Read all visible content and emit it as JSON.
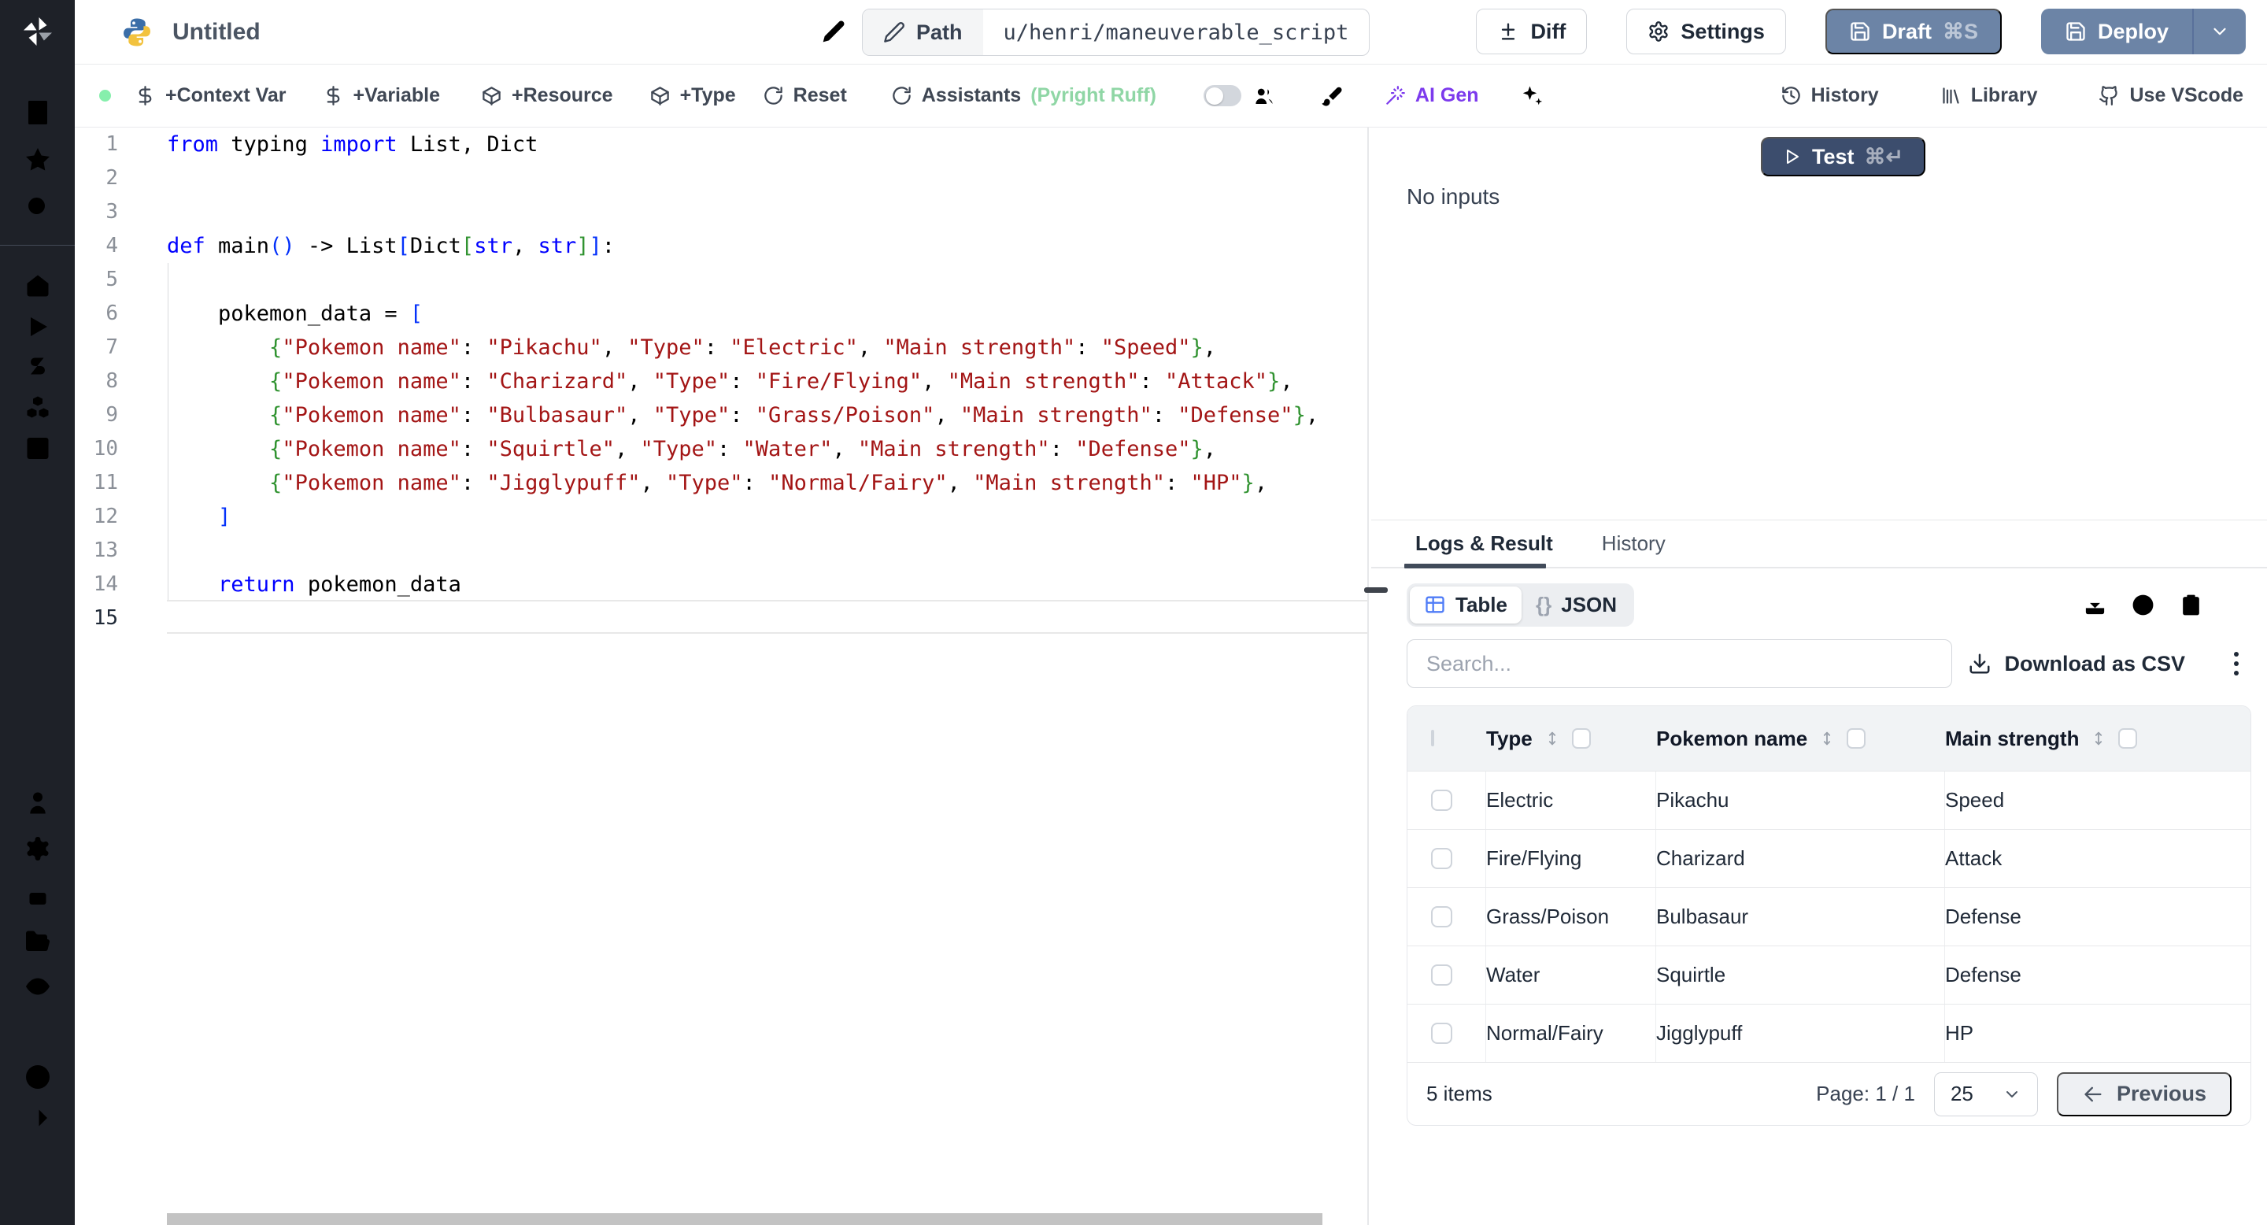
{
  "topbar": {
    "title": "Untitled",
    "path_label": "Path",
    "path_value": "u/henri/maneuverable_script",
    "diff_label": "Diff",
    "settings_label": "Settings",
    "draft_label": "Draft",
    "draft_kbd": "⌘S",
    "deploy_label": "Deploy"
  },
  "toolbar": {
    "context_var": "+Context Var",
    "variable": "+Variable",
    "resource": "+Resource",
    "type": "+Type",
    "reset": "Reset",
    "assistants": "Assistants",
    "assistants_status": "(Pyright Ruff)",
    "ai_gen": "AI Gen",
    "history": "History",
    "library": "Library",
    "use_vscode": "Use VScode"
  },
  "editor": {
    "current_line": 15,
    "lines": [
      [
        [
          "kw",
          "from"
        ],
        [
          "tx",
          " typing "
        ],
        [
          "kw",
          "import"
        ],
        [
          "tx",
          " List, Dict"
        ]
      ],
      [],
      [],
      [
        [
          "kw",
          "def"
        ],
        [
          "tx",
          " main"
        ],
        [
          "b1",
          "()"
        ],
        [
          "tx",
          " -> List"
        ],
        [
          "b1",
          "["
        ],
        [
          "tx",
          "Dict"
        ],
        [
          "b2",
          "["
        ],
        [
          "kw",
          "str"
        ],
        [
          "tx",
          ", "
        ],
        [
          "kw",
          "str"
        ],
        [
          "b2",
          "]"
        ],
        [
          "b1",
          "]"
        ],
        [
          "tx",
          ":"
        ]
      ],
      [],
      [
        [
          "tx",
          "    pokemon_data = "
        ],
        [
          "b1",
          "["
        ]
      ],
      [
        [
          "tx",
          "        "
        ],
        [
          "b2",
          "{"
        ],
        [
          "s",
          "\"Pokemon name\""
        ],
        [
          "tx",
          ": "
        ],
        [
          "s",
          "\"Pikachu\""
        ],
        [
          "tx",
          ", "
        ],
        [
          "s",
          "\"Type\""
        ],
        [
          "tx",
          ": "
        ],
        [
          "s",
          "\"Electric\""
        ],
        [
          "tx",
          ", "
        ],
        [
          "s",
          "\"Main strength\""
        ],
        [
          "tx",
          ": "
        ],
        [
          "s",
          "\"Speed\""
        ],
        [
          "b2",
          "}"
        ],
        [
          "tx",
          ","
        ]
      ],
      [
        [
          "tx",
          "        "
        ],
        [
          "b2",
          "{"
        ],
        [
          "s",
          "\"Pokemon name\""
        ],
        [
          "tx",
          ": "
        ],
        [
          "s",
          "\"Charizard\""
        ],
        [
          "tx",
          ", "
        ],
        [
          "s",
          "\"Type\""
        ],
        [
          "tx",
          ": "
        ],
        [
          "s",
          "\"Fire/Flying\""
        ],
        [
          "tx",
          ", "
        ],
        [
          "s",
          "\"Main strength\""
        ],
        [
          "tx",
          ": "
        ],
        [
          "s",
          "\"Attack\""
        ],
        [
          "b2",
          "}"
        ],
        [
          "tx",
          ","
        ]
      ],
      [
        [
          "tx",
          "        "
        ],
        [
          "b2",
          "{"
        ],
        [
          "s",
          "\"Pokemon name\""
        ],
        [
          "tx",
          ": "
        ],
        [
          "s",
          "\"Bulbasaur\""
        ],
        [
          "tx",
          ", "
        ],
        [
          "s",
          "\"Type\""
        ],
        [
          "tx",
          ": "
        ],
        [
          "s",
          "\"Grass/Poison\""
        ],
        [
          "tx",
          ", "
        ],
        [
          "s",
          "\"Main strength\""
        ],
        [
          "tx",
          ": "
        ],
        [
          "s",
          "\"Defense\""
        ],
        [
          "b2",
          "}"
        ],
        [
          "tx",
          ","
        ]
      ],
      [
        [
          "tx",
          "        "
        ],
        [
          "b2",
          "{"
        ],
        [
          "s",
          "\"Pokemon name\""
        ],
        [
          "tx",
          ": "
        ],
        [
          "s",
          "\"Squirtle\""
        ],
        [
          "tx",
          ", "
        ],
        [
          "s",
          "\"Type\""
        ],
        [
          "tx",
          ": "
        ],
        [
          "s",
          "\"Water\""
        ],
        [
          "tx",
          ", "
        ],
        [
          "s",
          "\"Main strength\""
        ],
        [
          "tx",
          ": "
        ],
        [
          "s",
          "\"Defense\""
        ],
        [
          "b2",
          "}"
        ],
        [
          "tx",
          ","
        ]
      ],
      [
        [
          "tx",
          "        "
        ],
        [
          "b2",
          "{"
        ],
        [
          "s",
          "\"Pokemon name\""
        ],
        [
          "tx",
          ": "
        ],
        [
          "s",
          "\"Jigglypuff\""
        ],
        [
          "tx",
          ", "
        ],
        [
          "s",
          "\"Type\""
        ],
        [
          "tx",
          ": "
        ],
        [
          "s",
          "\"Normal/Fairy\""
        ],
        [
          "tx",
          ", "
        ],
        [
          "s",
          "\"Main strength\""
        ],
        [
          "tx",
          ": "
        ],
        [
          "s",
          "\"HP\""
        ],
        [
          "b2",
          "}"
        ],
        [
          "tx",
          ","
        ]
      ],
      [
        [
          "tx",
          "    "
        ],
        [
          "b1",
          "]"
        ]
      ],
      [],
      [
        [
          "tx",
          "    "
        ],
        [
          "kw",
          "return"
        ],
        [
          "tx",
          " pokemon_data"
        ]
      ],
      []
    ]
  },
  "run_panel": {
    "test_label": "Test",
    "test_kbd": "⌘↵",
    "no_inputs": "No inputs"
  },
  "results": {
    "tabs": [
      "Logs & Result",
      "History"
    ],
    "active_tab": "Logs & Result",
    "view_table": "Table",
    "view_json_glyph": "{}",
    "view_json": "JSON",
    "search_placeholder": "Search...",
    "download_csv": "Download as CSV",
    "table": {
      "columns": [
        "Type",
        "Pokemon name",
        "Main strength"
      ],
      "rows": [
        [
          "Electric",
          "Pikachu",
          "Speed"
        ],
        [
          "Fire/Flying",
          "Charizard",
          "Attack"
        ],
        [
          "Grass/Poison",
          "Bulbasaur",
          "Defense"
        ],
        [
          "Water",
          "Squirtle",
          "Defense"
        ],
        [
          "Normal/Fairy",
          "Jigglypuff",
          "HP"
        ]
      ]
    },
    "footer": {
      "items": "5 items",
      "page": "Page: 1 / 1",
      "page_size": "25",
      "previous": "Previous"
    }
  },
  "colors": {
    "sidebar_bg": "#1e2128",
    "accent_button": "#6c84a6",
    "test_button": "#3c4d6d",
    "status_green": "#86efac",
    "assistants_green": "#8fd6a5",
    "ai_violet": "#7c3aed",
    "code_keyword": "#0000ff",
    "code_string": "#a31515",
    "bracket_level1": "#0431fa",
    "bracket_level2": "#319331",
    "table_icon_blue": "#4f7cf7"
  }
}
